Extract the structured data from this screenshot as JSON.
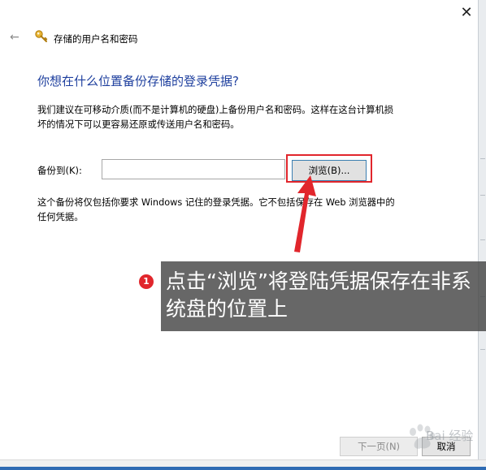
{
  "window": {
    "title": "存储的用户名和密码",
    "close_glyph": "✕",
    "back_glyph": "←"
  },
  "content": {
    "heading": "你想在什么位置备份存储的登录凭据?",
    "paragraph1": "我们建议在可移动介质(而不是计算机的硬盘)上备份用户名和密码。这样在这台计算机损坏的情况下可以更容易还原或传送用户名和密码。",
    "backup_label": "备份到(K):",
    "backup_path_value": "",
    "browse_label": "浏览(B)...",
    "paragraph2": "这个备份将仅包括你要求 Windows 记住的登录凭据。它不包括保存在 Web 浏览器中的任何凭据。"
  },
  "annotation": {
    "badge": "1",
    "callout": "点击“浏览”将登陆凭据保存在非系统盘的位置上",
    "highlight_color": "#e1262c"
  },
  "footer": {
    "next_label": "下一页(N)",
    "cancel_label": "取消"
  },
  "watermark": {
    "text": "Bai 经验"
  },
  "colors": {
    "heading": "#1e3f9e",
    "callout_bg": "#464646",
    "taskbar_accent": "#2f6bb3"
  }
}
